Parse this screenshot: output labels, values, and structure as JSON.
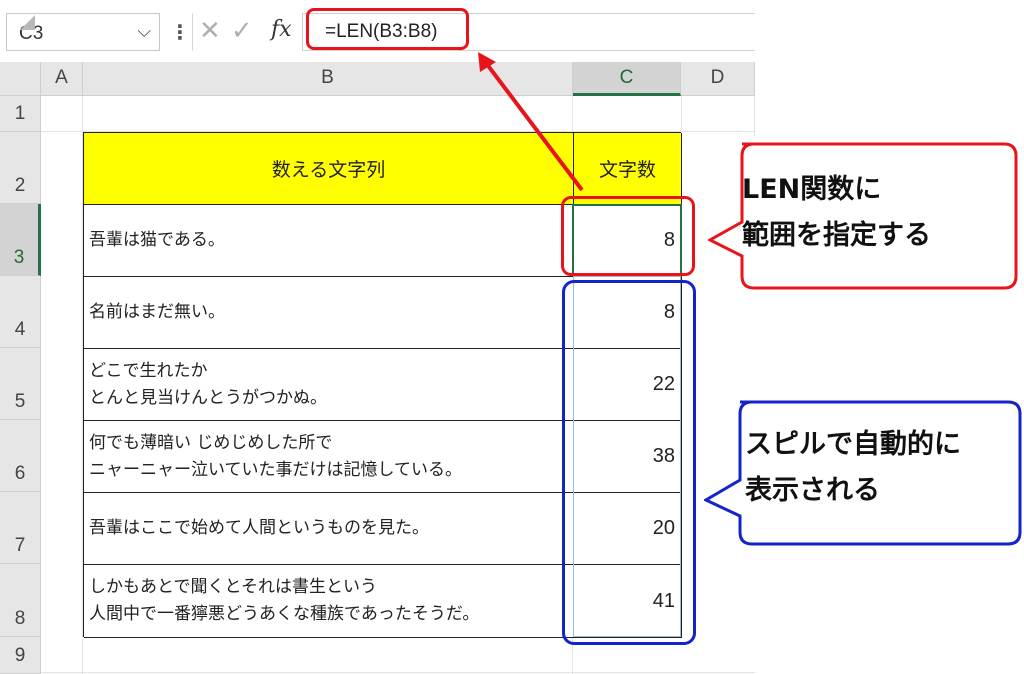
{
  "formula_bar": {
    "name_box": "C3",
    "formula": "=LEN(B3:B8)",
    "fx_label": "fx",
    "separator": "⋮"
  },
  "columns": [
    "A",
    "B",
    "C",
    "D"
  ],
  "rows": [
    "1",
    "2",
    "3",
    "4",
    "5",
    "6",
    "7",
    "8",
    "9"
  ],
  "table": {
    "header_b": "数える文字列",
    "header_c": "文字数",
    "rows": [
      {
        "b_lines": [
          "吾輩は猫である。"
        ],
        "c": "8"
      },
      {
        "b_lines": [
          "名前はまだ無い。"
        ],
        "c": "8"
      },
      {
        "b_lines": [
          "どこで生れたか",
          "とんと見当けんとうがつかぬ。"
        ],
        "c": "22"
      },
      {
        "b_lines": [
          "何でも薄暗い じめじめした所で",
          "ニャーニャー泣いていた事だけは記憶している。"
        ],
        "c": "38"
      },
      {
        "b_lines": [
          "吾輩はここで始めて人間というものを見た。"
        ],
        "c": "20"
      },
      {
        "b_lines": [
          "しかもあとで聞くとそれは書生という",
          "人間中で一番獰悪どうあくな種族であったそうだ。"
        ],
        "c": "41"
      }
    ]
  },
  "callouts": {
    "red": [
      "LEN関数に",
      "範囲を指定する"
    ],
    "blue": [
      "スピルで自動的に",
      "表示される"
    ]
  },
  "colors": {
    "accent_red": "#e8141c",
    "accent_blue": "#1524c8",
    "header_fill": "#ffff00",
    "excel_green": "#217346"
  }
}
